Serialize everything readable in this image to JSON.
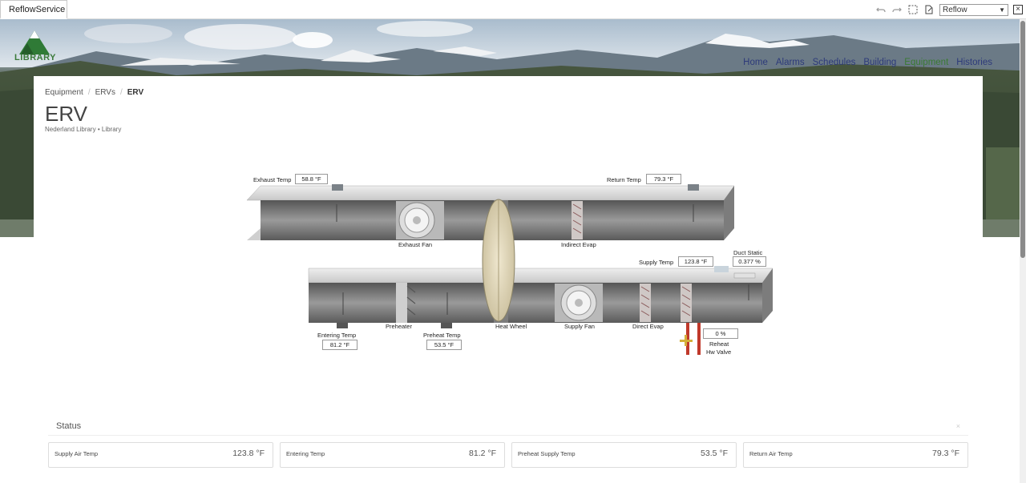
{
  "app": {
    "tab_title": "ReflowService",
    "select_value": "Reflow"
  },
  "nav": [
    "Home",
    "Alarms",
    "Schedules",
    "Building",
    "Equipment",
    "Histories"
  ],
  "logo_text": "LIBRARY",
  "breadcrumb": [
    "Equipment",
    "ERVs",
    "ERV"
  ],
  "page": {
    "title": "ERV",
    "subtitle_site": "Nederland Library",
    "subtitle_sep": "•",
    "subtitle_building": "Library"
  },
  "diagram": {
    "exhaust_temp": {
      "label": "Exhaust Temp",
      "value": "58.8 °F"
    },
    "return_temp": {
      "label": "Return Temp",
      "value": "79.3 °F"
    },
    "supply_temp": {
      "label": "Supply Temp",
      "value": "123.8 °F"
    },
    "duct_static": {
      "label": "Duct Static",
      "value": "0.377 %"
    },
    "entering_temp": {
      "label": "Entering Temp",
      "value": "81.2 °F"
    },
    "preheat_temp": {
      "label": "Preheat Temp",
      "value": "53.5 °F"
    },
    "reheat_valve": {
      "label_line1": "Reheat",
      "label_line2": "Hw Valve",
      "value": "0 %"
    },
    "components": {
      "exhaust_fan": "Exhaust Fan",
      "indirect_evap": "Indirect Evap",
      "preheater": "Preheater",
      "heat_wheel": "Heat Wheel",
      "supply_fan": "Supply Fan",
      "direct_evap": "Direct Evap"
    }
  },
  "status": {
    "title": "Status",
    "close": "×",
    "tiles": [
      {
        "label": "Supply Air Temp",
        "value": "123.8 °F"
      },
      {
        "label": "Entering Temp",
        "value": "81.2 °F"
      },
      {
        "label": "Preheat Supply Temp",
        "value": "53.5 °F"
      },
      {
        "label": "Return Air Temp",
        "value": "79.3 °F"
      }
    ]
  },
  "colors": {
    "nav_link": "#2d3a7a",
    "nav_active": "#3a7a32",
    "duct": "#8f8f8f",
    "hw_pipe": "#c0392b"
  }
}
